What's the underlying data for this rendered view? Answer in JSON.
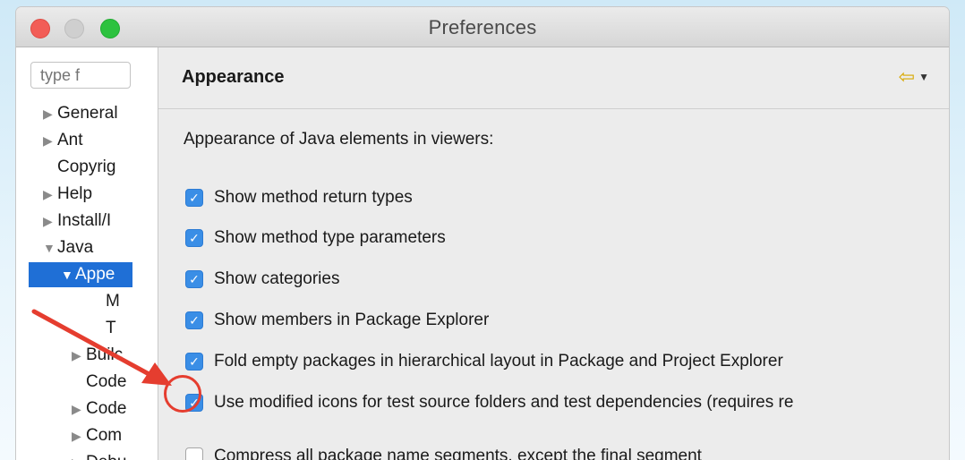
{
  "window": {
    "title": "Preferences"
  },
  "sidebar": {
    "filter_placeholder": "type f",
    "items": [
      {
        "label": "General",
        "tri": "▶"
      },
      {
        "label": "Ant",
        "tri": "▶"
      },
      {
        "label": "Copyrig",
        "tri": ""
      },
      {
        "label": "Help",
        "tri": "▶"
      },
      {
        "label": "Install/I",
        "tri": "▶"
      },
      {
        "label": "Java",
        "tri": "▼"
      },
      {
        "label": "Appe",
        "tri": "▼"
      },
      {
        "label": "M",
        "tri": ""
      },
      {
        "label": "T",
        "tri": ""
      },
      {
        "label": "Builc",
        "tri": "▶"
      },
      {
        "label": "Code",
        "tri": ""
      },
      {
        "label": "Code",
        "tri": "▶"
      },
      {
        "label": "Com",
        "tri": "▶"
      },
      {
        "label": "Debu",
        "tri": "▶"
      }
    ]
  },
  "page": {
    "title": "Appearance",
    "section_label": "Appearance of Java elements in viewers:",
    "options": [
      {
        "label": "Show method return types",
        "checked": true
      },
      {
        "label": "Show method type parameters",
        "checked": true
      },
      {
        "label": "Show categories",
        "checked": true
      },
      {
        "label": "Show members in Package Explorer",
        "checked": true
      },
      {
        "label": "Fold empty packages in hierarchical layout in Package and Project Explorer",
        "checked": true
      },
      {
        "label": "Use modified icons for test source folders and test dependencies (requires re",
        "checked": true
      },
      {
        "label": "Compress all package name segments, except the final segment",
        "checked": false
      }
    ]
  },
  "icons": {
    "back": "back-arrow-icon",
    "dropdown": "chevron-down-icon",
    "check": "check-icon"
  },
  "colors": {
    "selection": "#1f6fd6",
    "checkbox": "#3a8ee6",
    "annotation": "#e53d2f"
  }
}
